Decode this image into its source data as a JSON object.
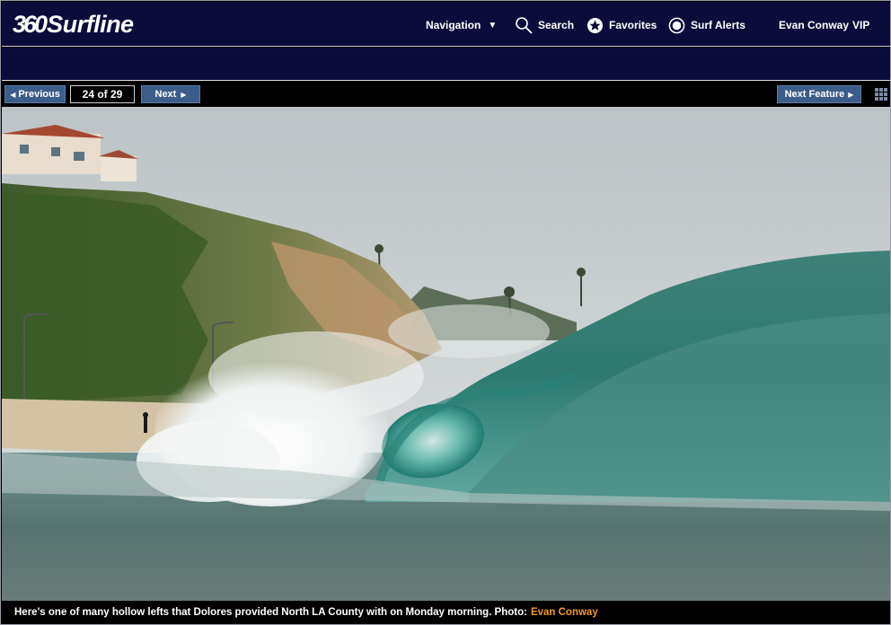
{
  "logo": {
    "number": "360",
    "wordmark": "Surfline"
  },
  "nav": {
    "navigation": "Navigation",
    "search": "Search",
    "favorites": "Favorites",
    "surf_alerts": "Surf Alerts",
    "user_name": "Evan Conway",
    "user_badge": "VIP"
  },
  "toolbar": {
    "previous": "Previous",
    "counter": "24 of 29",
    "next": "Next",
    "next_feature": "Next Feature"
  },
  "caption": {
    "text": "Here's one of many hollow lefts that Dolores provided North LA County with on Monday morning. Photo:",
    "credit": "Evan Conway"
  },
  "colors": {
    "header_bg": "#0c0c3c",
    "button_bg": "#3b5d8a",
    "credit_orange": "#f39a1f"
  },
  "icons": {
    "navigation": "chevron-down-icon",
    "search": "search-icon",
    "favorites": "star-icon",
    "surf_alerts": "alert-icon",
    "gallery": "grid-icon"
  }
}
